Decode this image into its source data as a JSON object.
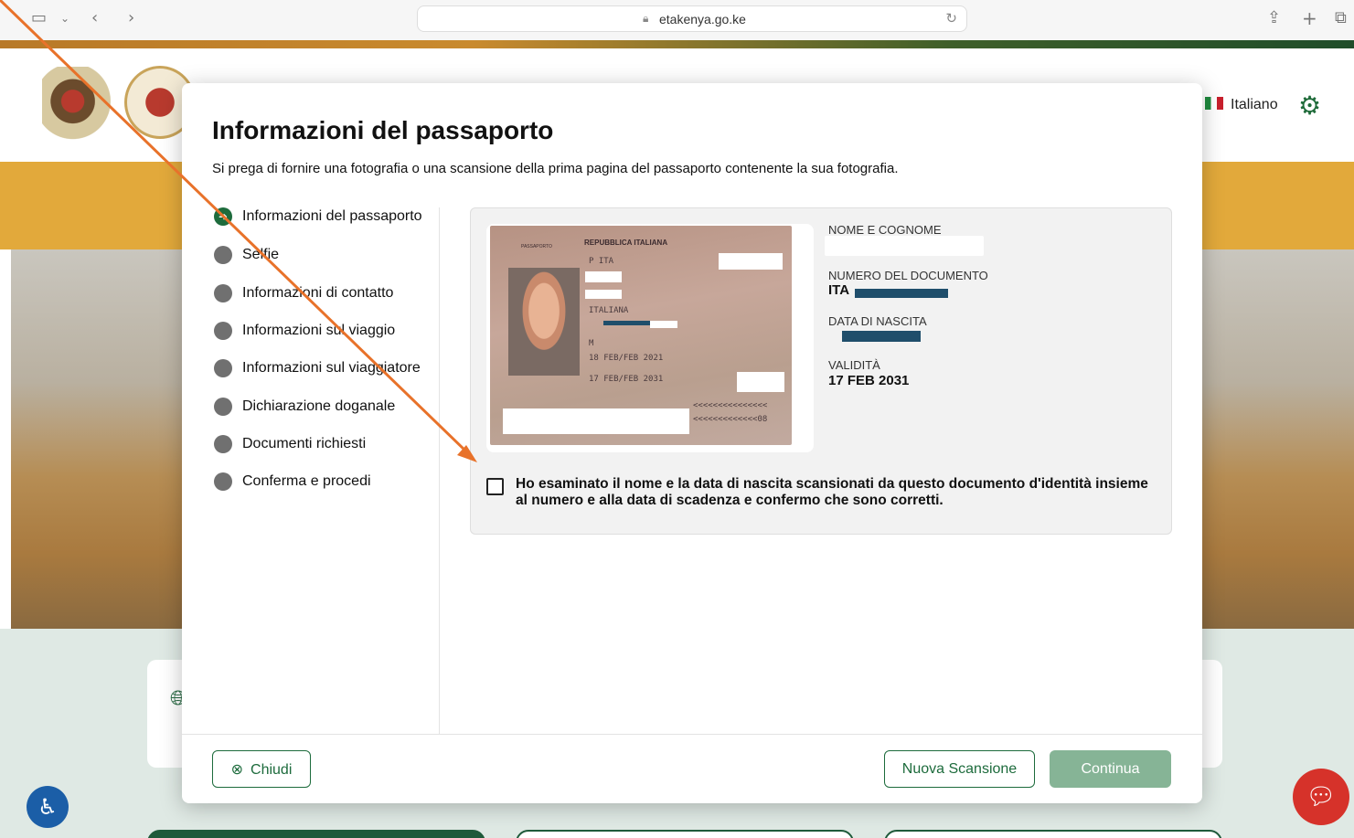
{
  "browser": {
    "url": "etakenya.go.ke",
    "icons": [
      "sidebar-icon",
      "chevron-down-icon",
      "back-icon",
      "forward-icon",
      "lock-icon",
      "reload-icon",
      "share-icon",
      "new-tab-icon",
      "tabs-icon"
    ]
  },
  "page": {
    "language": "Italiano"
  },
  "modal": {
    "title": "Informazioni del passaporto",
    "subtitle": "Si prega di fornire una fotografia o una scansione della prima pagina del passaporto contenente la sua fotografia.",
    "steps": [
      {
        "label": "Informazioni del passaporto",
        "active": true
      },
      {
        "label": "Selfie",
        "active": false
      },
      {
        "label": "Informazioni di contatto",
        "active": false
      },
      {
        "label": "Informazioni sul viaggio",
        "active": false
      },
      {
        "label": "Informazioni sul viaggiatore",
        "active": false
      },
      {
        "label": "Dichiarazione doganale",
        "active": false
      },
      {
        "label": "Documenti richiesti",
        "active": false
      },
      {
        "label": "Conferma e procedi",
        "active": false
      }
    ],
    "passport_image": {
      "header": "REPUBBLICA ITALIANA",
      "type_label": "PASSAPORTO",
      "code": "P   ITA",
      "nationality": "ITALIANA",
      "sex": "M",
      "issue_date": "18 FEB/FEB 2021",
      "expiry_date": "17 FEB/FEB 2031",
      "mrz1": "<<<<<<<<<<<<<<<",
      "mrz2": "<<<<<<<<<<<<<08"
    },
    "fields": {
      "name_label": "NOME E COGNOME",
      "doc_number_label": "NUMERO DEL DOCUMENTO",
      "doc_number_value": "ITA",
      "dob_label": "DATA DI NASCITA",
      "validity_label": "VALIDITÀ",
      "validity_value": "17 FEB 2031"
    },
    "confirm_text": "Ho esaminato il nome e la data di nascita scansionati da questo documento d'identità insieme al numero e alla data di scadenza e confermo che sono corretti.",
    "confirm_checked": false,
    "buttons": {
      "close": "Chiudi",
      "new_scan": "Nuova Scansione",
      "continue": "Continua"
    }
  },
  "colors": {
    "primary": "#1d6b3c",
    "continue_disabled": "#86b496",
    "annotation_arrow": "#e8722a"
  }
}
